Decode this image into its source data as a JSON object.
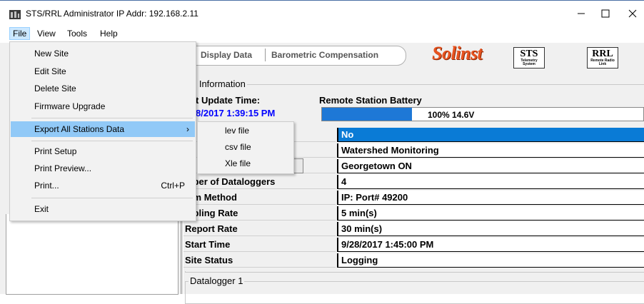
{
  "window": {
    "title": "STS/RRL Administrator IP Addr: 192.168.2.11",
    "controls": {
      "minimize": "—",
      "maximize": "☐",
      "close": "✕"
    }
  },
  "menubar": {
    "file": "File",
    "view": "View",
    "tools": "Tools",
    "help": "Help"
  },
  "file_menu": {
    "items": [
      {
        "label": "New Site"
      },
      {
        "label": "Edit Site"
      },
      {
        "label": "Delete Site"
      },
      {
        "label": "Firmware Upgrade"
      },
      {
        "label": "Export All Stations Data",
        "arrow": "›"
      },
      {
        "label": "Print Setup"
      },
      {
        "label": "Print Preview..."
      },
      {
        "label": "Print...",
        "shortcut": "Ctrl+P"
      },
      {
        "label": "Exit"
      }
    ]
  },
  "export_submenu": {
    "items": [
      {
        "label": "lev file"
      },
      {
        "label": "csv file"
      },
      {
        "label": "Xle file"
      }
    ]
  },
  "toolbar": {
    "tab_display": "Display Data",
    "tab_baro": "Barometric Compensation",
    "logo_solinst": "Solinst",
    "logo_sts": "STS",
    "logo_sts_sub": "Telemetry System",
    "logo_rrl": "RRL",
    "logo_rrl_sub": "Remote Radio Link"
  },
  "site_info": {
    "group_title": "e Information",
    "last_update_label": "t Update Time:",
    "last_update_value": "8/2017 1:39:15 PM",
    "battery_label": "Remote Station Battery",
    "battery_text": "100% 14.6V",
    "battery_level": 0.28,
    "battery_color": "#1e78d6"
  },
  "grid": [
    {
      "label": "",
      "value": "No",
      "selected": true
    },
    {
      "label": "",
      "value": "Watershed Monitoring"
    },
    {
      "label": "",
      "value": "Georgetown ON"
    },
    {
      "label": "mber of Dataloggers",
      "value": "4"
    },
    {
      "label": "mm Method",
      "value": "IP: Port# 49200"
    },
    {
      "label": "mpling Rate",
      "value": "5 min(s)"
    },
    {
      "label": "Report Rate",
      "value": "30 min(s)"
    },
    {
      "label": "Start Time",
      "value": "9/28/2017 1:45:00 PM"
    },
    {
      "label": "Site Status",
      "value": "Logging"
    }
  ],
  "datalogger": {
    "title": "Datalogger 1"
  }
}
